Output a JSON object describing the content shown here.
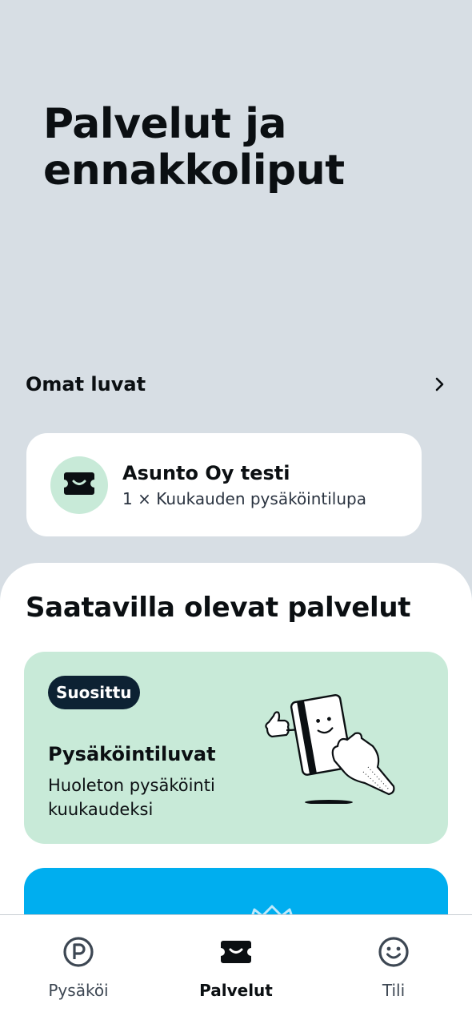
{
  "page": {
    "title": "Palvelut ja ennakkoliput"
  },
  "own_permits": {
    "header": "Omat luvat",
    "card": {
      "title": "Asunto Oy testi",
      "subtitle": "1 × Kuukauden pysäköintilupa",
      "icon": "ticket-icon"
    }
  },
  "available_services": {
    "title": "Saatavilla olevat palvelut",
    "cards": [
      {
        "badge": "Suosittu",
        "title": "Pysäköintiluvat",
        "description": "Huoleton pysäköinti kuukaudeksi",
        "illustration": "card-hand-illustration",
        "bg": "#c8ead8"
      },
      {
        "bg": "#00aeef",
        "illustration": "crown-illustration"
      }
    ]
  },
  "bottom_nav": {
    "items": [
      {
        "label": "Pysäköi",
        "icon": "parking-icon",
        "active": false
      },
      {
        "label": "Palvelut",
        "icon": "ticket-icon",
        "active": true
      },
      {
        "label": "Tili",
        "icon": "smiley-icon",
        "active": false
      }
    ]
  },
  "colors": {
    "background": "#d7dee4",
    "accent_green": "#c8ead8",
    "accent_blue": "#00aeef",
    "badge": "#0d2233"
  }
}
